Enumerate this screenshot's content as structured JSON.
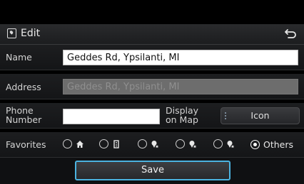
{
  "header": {
    "title": "Edit",
    "edit_icon": "location-pin-icon",
    "back_icon": "back-arrow-icon"
  },
  "name": {
    "label": "Name",
    "value": "Geddes Rd, Ypsilanti, MI"
  },
  "address": {
    "label": "Address",
    "placeholder": "Geddes Rd, Ypsilanti, MI"
  },
  "phone": {
    "label_line1": "Phone",
    "label_line2": "Number",
    "value": ""
  },
  "display_on_map": {
    "label_line1": "Display",
    "label_line2": "on Map",
    "button_label": "Icon"
  },
  "favorites": {
    "label": "Favorites",
    "options": [
      {
        "icon": "home-icon",
        "selected": false
      },
      {
        "icon": "building-icon",
        "selected": false
      },
      {
        "icon": "favorite-1-icon",
        "selected": false
      },
      {
        "icon": "favorite-2-icon",
        "selected": false
      },
      {
        "icon": "favorite-3-icon",
        "selected": false
      },
      {
        "text": "Others",
        "selected": true
      }
    ]
  },
  "save": {
    "label": "Save"
  },
  "colors": {
    "accent": "#4bb3e0",
    "background": "#000000"
  }
}
